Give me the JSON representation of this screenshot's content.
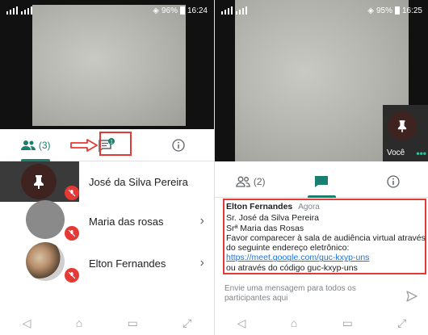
{
  "left": {
    "status": {
      "network": "⚟",
      "battery": "96%",
      "time": "16:24"
    },
    "tabs": {
      "people_count": "(3)"
    },
    "chat_badge": "1",
    "participants": [
      {
        "name": "José da Silva Pereira"
      },
      {
        "name": "Maria das rosas"
      },
      {
        "name": "Elton Fernandes"
      }
    ]
  },
  "right": {
    "status": {
      "battery": "95%",
      "time": "16:25"
    },
    "self_label": "Você",
    "self_more": "•••",
    "tabs": {
      "people_count": "(2)"
    },
    "message": {
      "author": "Elton Fernandes",
      "time": "Agora",
      "lines": [
        "Sr. José da Silva Pereira",
        "Srª Maria das Rosas",
        "Favor comparecer à sala de audiência virtual através",
        "do seguinte endereço eletrônico:"
      ],
      "link": "https://meet.google.com/guc-kxyp-uns",
      "footer": "ou através do código guc-kxyp-uns"
    },
    "compose_placeholder": "Envie uma mensagem para todos os participantes aqui"
  },
  "colors": {
    "accent": "#1a7f6e",
    "highlight": "#e53935",
    "link": "#1a73e8"
  },
  "icons": [
    "people-icon",
    "chat-icon",
    "info-icon",
    "mic-off-icon",
    "send-icon",
    "back-icon",
    "home-icon",
    "recents-icon"
  ]
}
